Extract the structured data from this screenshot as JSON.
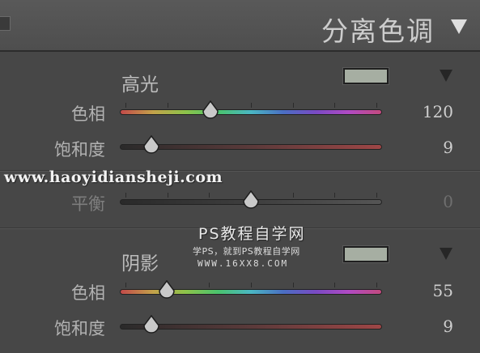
{
  "header": {
    "title": "分离色调"
  },
  "highlights": {
    "title": "高光",
    "swatch_color": "#a6aea2",
    "hue": {
      "label": "色相",
      "value": "120",
      "fraction": 0.345
    },
    "saturation": {
      "label": "饱和度",
      "value": "9",
      "fraction": 0.12
    }
  },
  "balance": {
    "label": "平衡",
    "value": "0",
    "fraction": 0.5
  },
  "shadows": {
    "title": "阴影",
    "swatch_color": "#a6aea2",
    "hue": {
      "label": "色相",
      "value": "55",
      "fraction": 0.18
    },
    "saturation": {
      "label": "饱和度",
      "value": "9",
      "fraction": 0.12
    }
  },
  "watermarks": {
    "url": "www.haoyidiansheji.com",
    "line1": "PS教程自学网",
    "line2": "学PS，就到PS教程自学网",
    "line3": "WWW.16XX8.COM"
  }
}
